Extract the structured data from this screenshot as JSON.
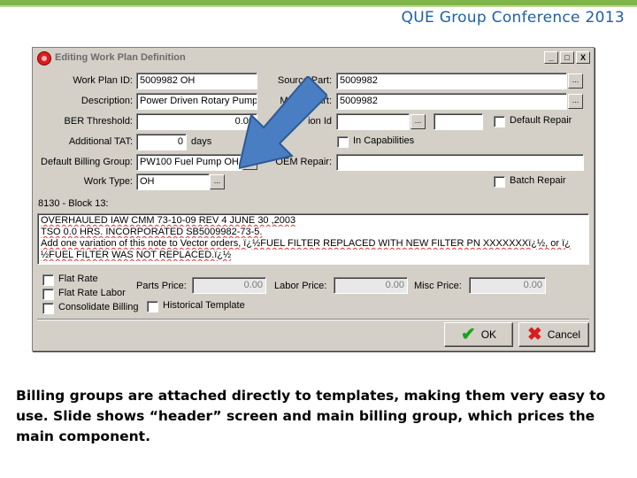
{
  "slide": {
    "header_title": "QUE Group Conference 2013",
    "caption": "Billing groups are attached directly to templates, making them very easy to use. Slide shows “header” screen and main billing group, which prices the main component."
  },
  "window": {
    "title": "Editing Work Plan Definition",
    "controls": {
      "minimize": "_",
      "maximize": "□",
      "close": "X"
    }
  },
  "form": {
    "work_plan_id": {
      "label": "Work Plan ID:",
      "value": "5009982 OH"
    },
    "description": {
      "label": "Description:",
      "value": "Power Driven Rotary Pump"
    },
    "ber_threshold": {
      "label": "BER Threshold:",
      "value": "0.00"
    },
    "additional_tat": {
      "label": "Additional TAT:",
      "value": "0",
      "unit": "days"
    },
    "default_billing_group": {
      "label": "Default Billing Group:",
      "value": "PW100 Fuel Pump OH"
    },
    "work_type": {
      "label": "Work Type:",
      "value": "OH"
    },
    "source_part": {
      "label": "Source Part:",
      "value": "5009982"
    },
    "modify_part": {
      "label": "Modify Part:",
      "value": "5009982"
    },
    "revision_id": {
      "label": "ion Id",
      "value": "",
      "extra": ""
    },
    "oem_repair": {
      "label": "OEM Repair:",
      "value": ""
    },
    "default_repair": {
      "label": "Default Repair",
      "checked": false
    },
    "in_capabilities": {
      "label": "In Capabilities",
      "checked": false
    },
    "batch_repair": {
      "label": "Batch Repair",
      "checked": false
    },
    "ellipsis": "..."
  },
  "block13": {
    "label": "8130 - Block 13:",
    "lines": [
      "OVERHAULED IAW CMM 73-10-09   REV 4 JUNE 30 ,2003",
      "TSO 0.0 HRS. INCORPORATED SB5009982-73-5.",
      "Add one variation of this note to Vector orders, ï¿½FUEL FILTER REPLACED WITH NEW FILTER PN XXXXXXXï¿½, or ï¿",
      "½FUEL FILTER WAS NOT REPLACED.ï¿½"
    ]
  },
  "options": {
    "flat_rate": {
      "label": "Flat Rate",
      "checked": false
    },
    "flat_rate_labor": {
      "label": "Flat Rate Labor",
      "checked": false
    },
    "consolidate_billing": {
      "label": "Consolidate Billing",
      "checked": false
    },
    "historical_template": {
      "label": "Historical Template",
      "checked": false
    }
  },
  "prices": {
    "parts": {
      "label": "Parts Price:",
      "value": "0.00"
    },
    "labor": {
      "label": "Labor Price:",
      "value": "0.00"
    },
    "misc": {
      "label": "Misc Price:",
      "value": "0.00"
    }
  },
  "buttons": {
    "ok": "OK",
    "cancel": "Cancel"
  },
  "icons": {
    "title": "app-icon",
    "ok": "checkmark-icon",
    "cancel": "x-icon",
    "annotation": "blue-arrow-icon"
  },
  "colors": {
    "accent_green": "#7fb54a",
    "title_blue": "#1f5fa6",
    "arrow_blue": "#4a7ec2",
    "window_gray": "#d4d0c8"
  }
}
